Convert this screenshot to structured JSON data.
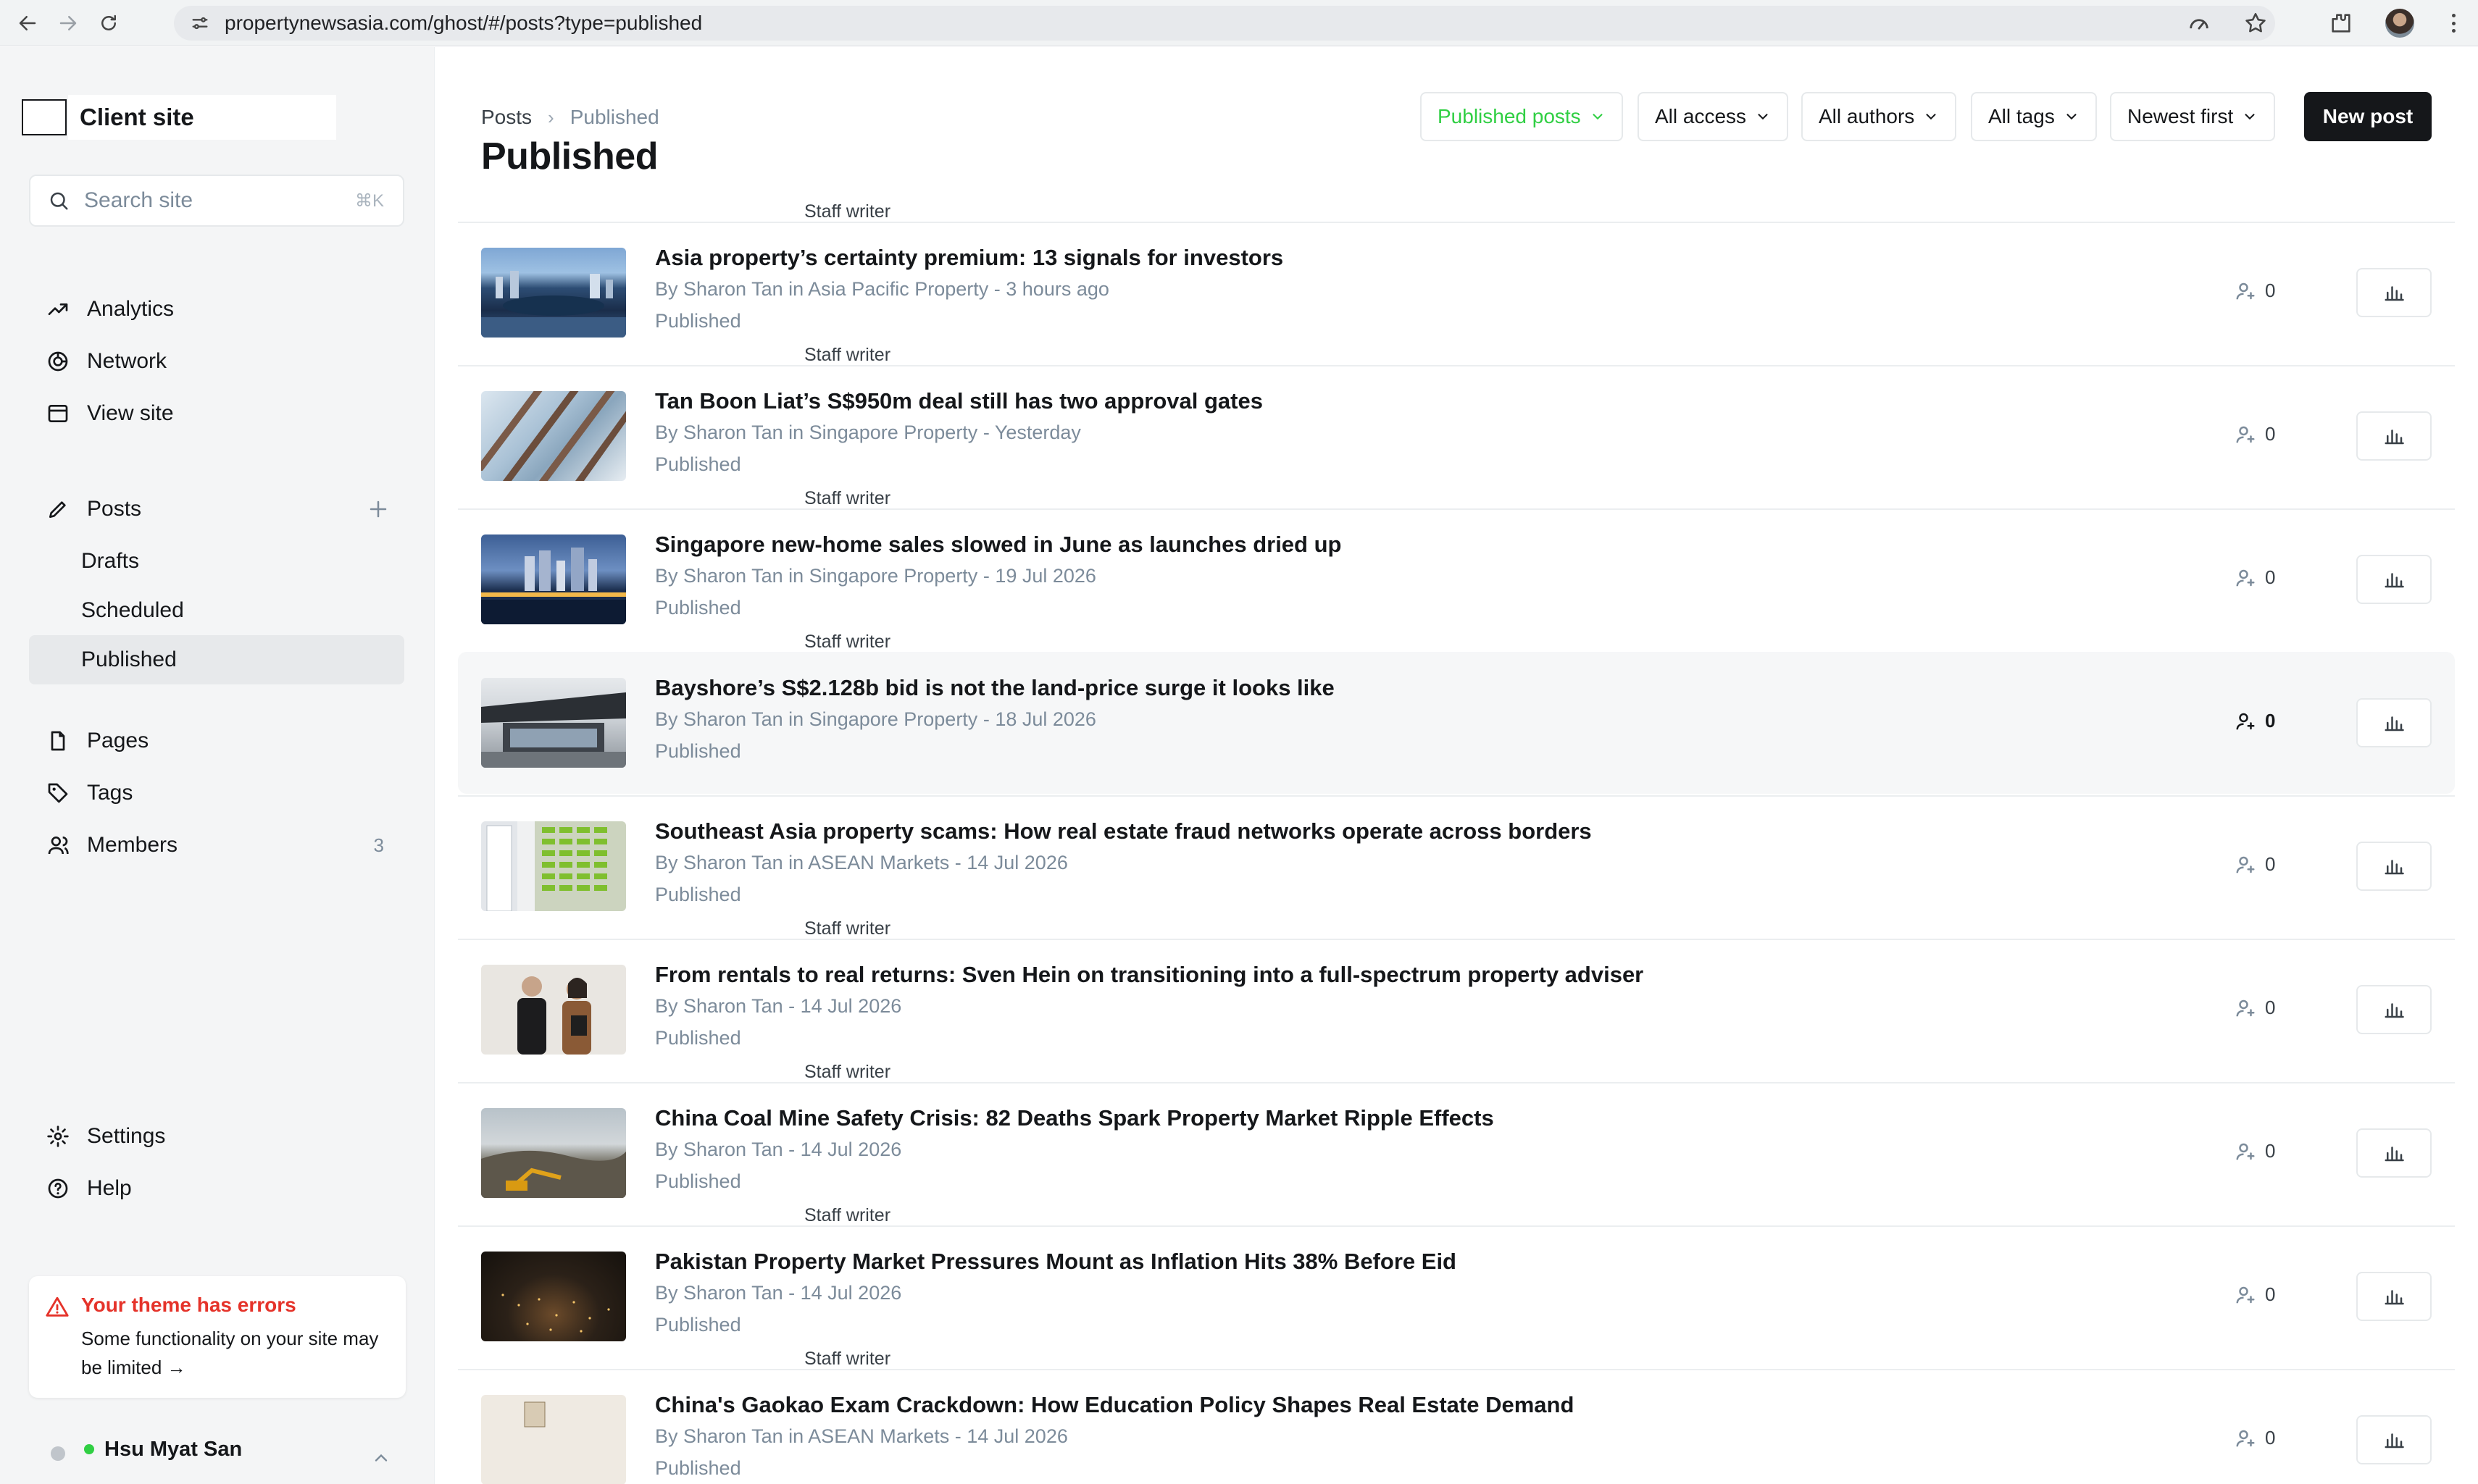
{
  "browser": {
    "url": "propertynewsasia.com/ghost/#/posts?type=published"
  },
  "sidebar": {
    "site_name": "Client site",
    "search_placeholder": "Search site",
    "search_shortcut": "⌘K",
    "nav_top": [
      {
        "label": "Analytics",
        "icon": "analytics-icon"
      },
      {
        "label": "Network",
        "icon": "network-icon"
      },
      {
        "label": "View site",
        "icon": "view-site-icon"
      }
    ],
    "posts_label": "Posts",
    "posts_sub": [
      {
        "label": "Drafts",
        "active": false
      },
      {
        "label": "Scheduled",
        "active": false
      },
      {
        "label": "Published",
        "active": true
      }
    ],
    "nav_mid": [
      {
        "label": "Pages",
        "icon": "page-icon"
      },
      {
        "label": "Tags",
        "icon": "tag-icon"
      },
      {
        "label": "Members",
        "icon": "members-icon",
        "count": "3"
      }
    ],
    "nav_bottom": [
      {
        "label": "Settings",
        "icon": "gear-icon"
      },
      {
        "label": "Help",
        "icon": "help-icon"
      }
    ],
    "theme_error": {
      "title": "Your theme has errors",
      "body": "Some functionality on your site may be limited →"
    },
    "user_name": "Hsu Myat San"
  },
  "header": {
    "breadcrumb_root": "Posts",
    "breadcrumb_current": "Published",
    "title": "Published",
    "filters": [
      "Published posts",
      "All access",
      "All authors",
      "All tags",
      "Newest first"
    ],
    "new_post": "New post"
  },
  "colors": {
    "accent_green": "#30cf43",
    "error_red": "#e5332a",
    "primary_dark": "#15171a"
  },
  "staff_tag": "Staff writer",
  "posts": [
    {
      "title": "Asia property’s certainty premium: 13 signals for investors",
      "by": "By Sharon Tan",
      "in": "in",
      "tag": "Asia Pacific Property",
      "time": "- 3 hours ago",
      "status": "Published",
      "members": "0"
    },
    {
      "title": "Tan Boon Liat’s S$950m deal still has two approval gates",
      "by": "By Sharon Tan",
      "in": "in",
      "tag": "Singapore Property",
      "time": "- Yesterday",
      "status": "Published",
      "members": "0"
    },
    {
      "title": "Singapore new-home sales slowed in June as launches dried up",
      "by": "By Sharon Tan",
      "in": "in",
      "tag": "Singapore Property",
      "time": "- 19 Jul 2026",
      "status": "Published",
      "members": "0"
    },
    {
      "title": "Bayshore’s S$2.128b bid is not the land-price surge it looks like",
      "by": "By Sharon Tan",
      "in": "in",
      "tag": "Singapore Property",
      "time": "- 18 Jul 2026",
      "status": "Published",
      "members": "0"
    },
    {
      "title": "Southeast Asia property scams: How real estate fraud networks operate across borders",
      "by": "By Sharon Tan",
      "in": "in",
      "tag": "ASEAN Markets",
      "time": "- 14 Jul 2026",
      "status": "Published",
      "members": "0"
    },
    {
      "title": "From rentals to real returns: Sven Hein on transitioning into a full-spectrum property adviser",
      "by": "By Sharon Tan",
      "in": "",
      "tag": "",
      "time": "- 14 Jul 2026",
      "status": "Published",
      "members": "0"
    },
    {
      "title": "China Coal Mine Safety Crisis: 82 Deaths Spark Property Market Ripple Effects",
      "by": "By Sharon Tan",
      "in": "",
      "tag": "",
      "time": "- 14 Jul 2026",
      "status": "Published",
      "members": "0"
    },
    {
      "title": "Pakistan Property Market Pressures Mount as Inflation Hits 38% Before Eid",
      "by": "By Sharon Tan",
      "in": "",
      "tag": "",
      "time": "- 14 Jul 2026",
      "status": "Published",
      "members": "0"
    },
    {
      "title": "China's Gaokao Exam Crackdown: How Education Policy Shapes Real Estate Demand",
      "by": "By Sharon Tan",
      "in": "in",
      "tag": "ASEAN Markets",
      "time": "- 14 Jul 2026",
      "status": "Published",
      "members": "0"
    }
  ]
}
